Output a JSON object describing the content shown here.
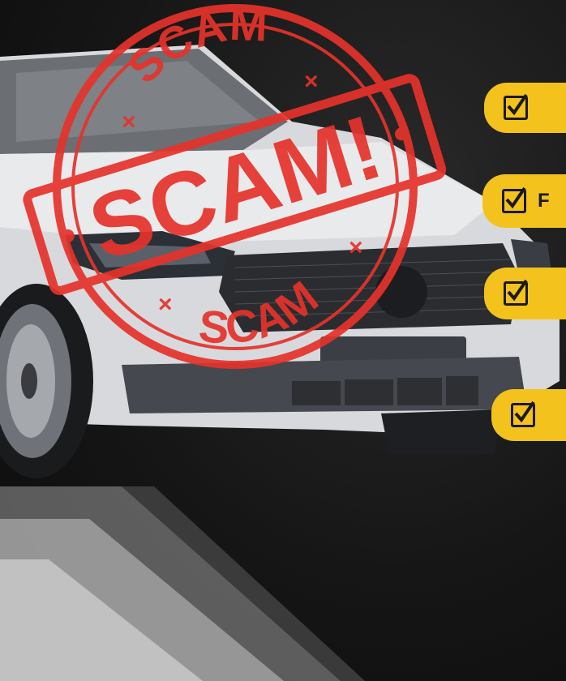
{
  "stamp": {
    "main_text": "SCAM!",
    "arc_top_text": "SCAM",
    "arc_bottom_text": "SCAM",
    "color": "#e5332b"
  },
  "checklist": {
    "color": "#f4c21c",
    "items": [
      {
        "icon": "checkbox-check-icon",
        "label": ""
      },
      {
        "icon": "checkbox-check-icon",
        "label": "F"
      },
      {
        "icon": "checkbox-check-icon",
        "label": ""
      },
      {
        "icon": "checkbox-check-icon",
        "label": ""
      }
    ]
  }
}
